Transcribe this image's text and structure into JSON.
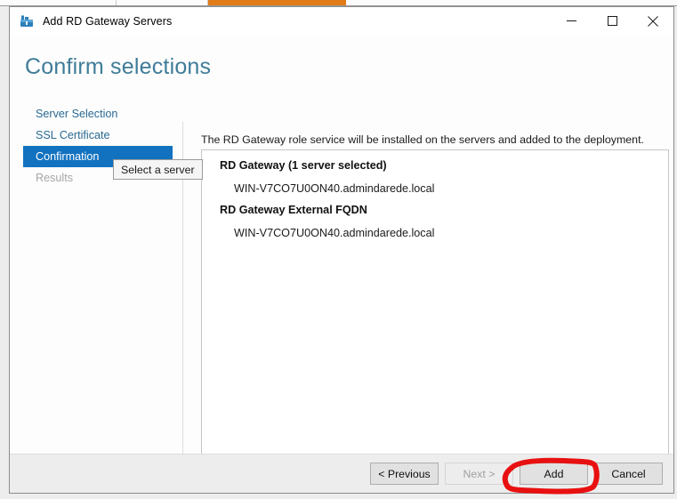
{
  "window": {
    "title": "Add RD Gateway Servers",
    "icon": "rd-gateway-icon",
    "controls": {
      "minimize": "minimize-icon",
      "maximize": "maximize-icon",
      "close": "close-icon"
    }
  },
  "wizard": {
    "page_title": "Confirm selections",
    "nav": [
      {
        "label": "Server Selection",
        "state": "enabled"
      },
      {
        "label": "SSL Certificate",
        "state": "enabled"
      },
      {
        "label": "Confirmation",
        "state": "selected"
      },
      {
        "label": "Results",
        "state": "disabled"
      }
    ],
    "tooltip": "Select a server",
    "intro": "The RD Gateway role service will be installed on the servers and added to the deployment.",
    "groups": [
      {
        "title": "RD Gateway  (1 server selected)",
        "value": "WIN-V7CO7U0ON40.admindarede.local"
      },
      {
        "title": "RD Gateway External FQDN",
        "value": "WIN-V7CO7U0ON40.admindarede.local"
      }
    ]
  },
  "footer": {
    "previous": "< Previous",
    "next": "Next >",
    "add": "Add",
    "cancel": "Cancel"
  },
  "annotation": {
    "kind": "red-circle-highlight",
    "target": "Add",
    "color": "#e81010"
  },
  "colors": {
    "accent_blue": "#1272c0",
    "title_blue": "#3f7c98",
    "link_blue": "#2a6a92",
    "annotation_red": "#e81010",
    "background_orange_tab": "#e07b18"
  }
}
